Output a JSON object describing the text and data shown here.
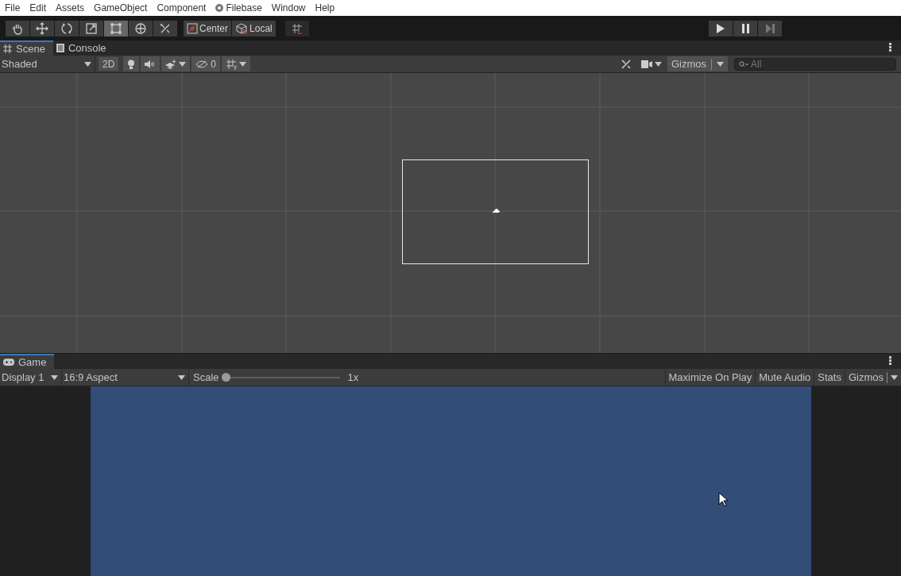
{
  "menu_bar": [
    {
      "label": "File"
    },
    {
      "label": "Edit"
    },
    {
      "label": "Assets"
    },
    {
      "label": "GameObject"
    },
    {
      "label": "Component"
    },
    {
      "label": "Filebase",
      "icon": true
    },
    {
      "label": "Window"
    },
    {
      "label": "Help"
    }
  ],
  "tools": [
    {
      "kind": "hand",
      "selected": false
    },
    {
      "kind": "move",
      "selected": false
    },
    {
      "kind": "rotate",
      "selected": false
    },
    {
      "kind": "scale",
      "selected": false
    },
    {
      "kind": "rect",
      "selected": true
    },
    {
      "kind": "transform",
      "selected": false
    },
    {
      "kind": "custom",
      "selected": false
    }
  ],
  "pivot": [
    {
      "kind": "center",
      "label": "Center"
    },
    {
      "kind": "local",
      "label": "Local"
    }
  ],
  "playback": [
    {
      "kind": "play",
      "disabled": false
    },
    {
      "kind": "pause",
      "disabled": false
    },
    {
      "kind": "step",
      "disabled": true
    }
  ],
  "scene_panel": {
    "tabs": [
      {
        "label": "Scene",
        "kind": "scene",
        "selected": true
      },
      {
        "label": "Console",
        "kind": "console",
        "selected": false
      }
    ],
    "shading": "Shaded",
    "mode_2d": "2D",
    "hidden_count": "0",
    "gizmos": "Gizmos",
    "search": {
      "placeholder": "All"
    }
  },
  "game_panel": {
    "tabs": [
      {
        "label": "Game",
        "kind": "game",
        "selected": true
      }
    ],
    "display": "Display 1",
    "aspect": "16:9 Aspect",
    "scale": {
      "label": "Scale",
      "level": 0,
      "reading": "1x"
    },
    "toggles": [
      {
        "label": "Maximize On Play",
        "on": false
      },
      {
        "label": "Mute Audio",
        "on": false
      },
      {
        "label": "Stats",
        "on": false
      }
    ],
    "gizmos": "Gizmos"
  }
}
